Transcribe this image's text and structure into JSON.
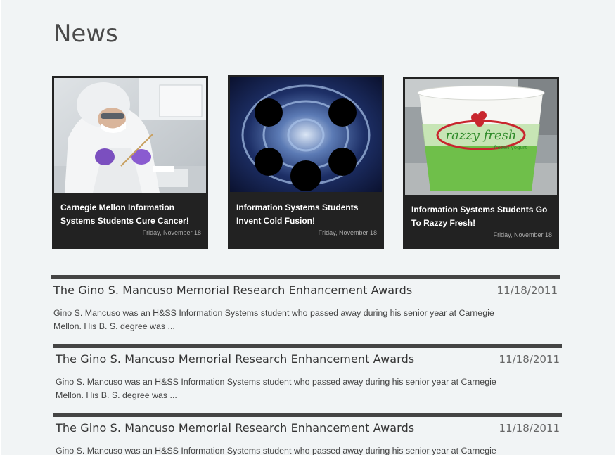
{
  "page": {
    "title": "News"
  },
  "featured": [
    {
      "title": "Carnegie Mellon Information Systems Students Cure Cancer!",
      "date": "Friday, November 18"
    },
    {
      "title": "Information Systems Students Invent Cold Fusion!",
      "date": "Friday, November 18"
    },
    {
      "title": "Information Systems Students Go To Razzy Fresh!",
      "date": "Friday, November 18",
      "cup_text": "razzy fresh",
      "cup_subtext": "frozen yogurt"
    }
  ],
  "articles": [
    {
      "title": "The Gino S. Mancuso Memorial Research Enhancement Awards",
      "date": "11/18/2011",
      "excerpt": "Gino S. Mancuso was an H&SS Information Systems student who passed away during his senior year at Carnegie Mellon.  His B. S. degree was ..."
    },
    {
      "title": "The Gino S. Mancuso Memorial Research Enhancement Awards",
      "date": "11/18/2011",
      "excerpt": "Gino S. Mancuso was an H&SS Information Systems student who passed away during his senior year at Carnegie Mellon.  His B. S. degree was ..."
    },
    {
      "title": "The Gino S. Mancuso Memorial Research Enhancement Awards",
      "date": "11/18/2011",
      "excerpt": "Gino S. Mancuso was an H&SS Information Systems student who passed away during his senior year at Carnegie Mellon.  His B. S. degree was ..."
    }
  ]
}
